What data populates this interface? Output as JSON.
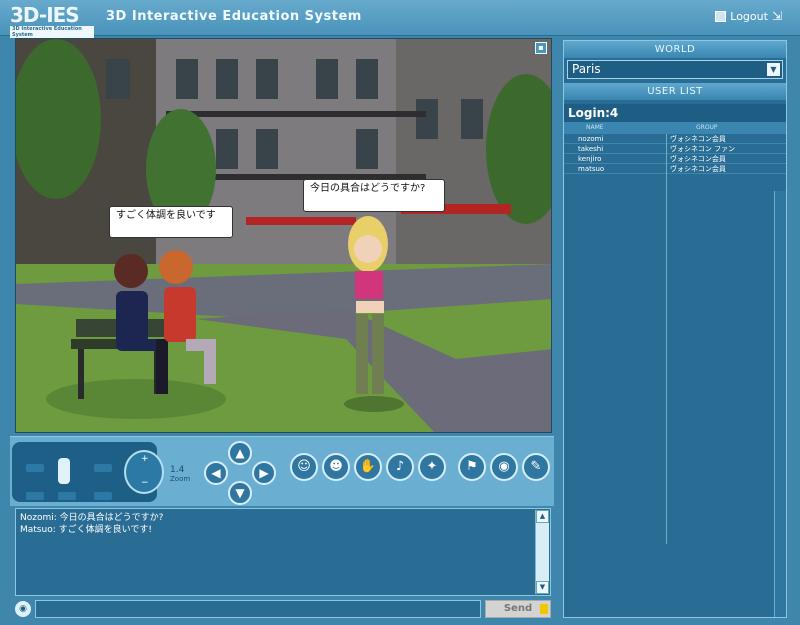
{
  "header": {
    "logo_text": "3D-IES",
    "logo_subtext": "3D Interactive Education System",
    "title": "3D Interactive Education System",
    "logout_label": "Logout"
  },
  "scene": {
    "bubble_left": "すごく体調を良いです",
    "bubble_right": "今日の具合はどうですか?"
  },
  "controls": {
    "zoom_value": "1.4",
    "zoom_label": "Zoom"
  },
  "chat": {
    "lines": [
      "Nozomi: 今日の具合はどうですか?",
      "Matsuo: すごく体調を良いです!"
    ],
    "input_value": "",
    "send_label": "Send"
  },
  "panel": {
    "world_header": "WORLD",
    "world_value": "Paris",
    "userlist_header": "USER LIST",
    "login_count": "Login:4",
    "col_name": "NAME",
    "col_group": "GROUP",
    "users": [
      {
        "name": "nozomi",
        "group": "ヴォシネコン会員"
      },
      {
        "name": "takeshi",
        "group": "ヴォシネコン ファン"
      },
      {
        "name": "kenjiro",
        "group": "ヴォシネコン会員"
      },
      {
        "name": "matsuo",
        "group": "ヴォシネコン会員"
      }
    ]
  },
  "colors": {
    "background": "#3f86ac",
    "panel": "#2a6d94",
    "accent": "#67aacd"
  }
}
